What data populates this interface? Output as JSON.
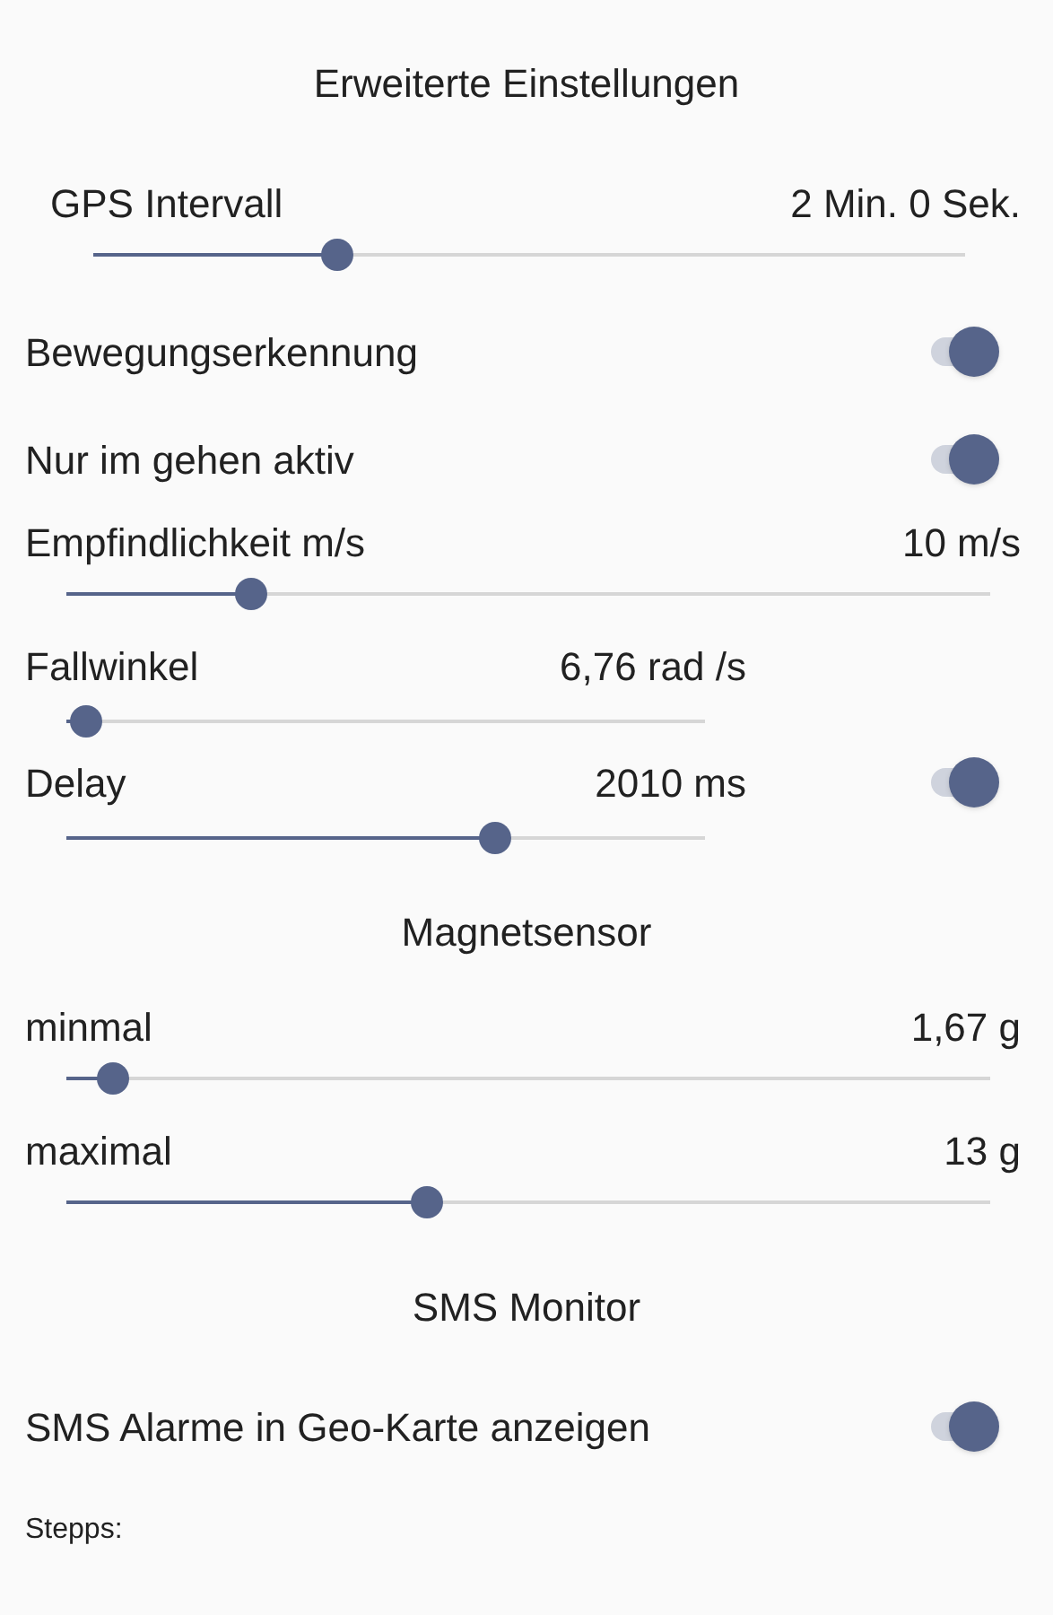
{
  "title": "Erweiterte Einstellungen",
  "items": [
    {
      "kind": "slider",
      "label": "GPS Intervall",
      "reading": "2 Min. 0 Sek.",
      "level": 0.28,
      "indented": true
    },
    {
      "kind": "switch",
      "label": "Bewegungserkennung",
      "on": true
    },
    {
      "kind": "switch",
      "label": "Nur im gehen aktiv",
      "on": true
    },
    {
      "kind": "slider",
      "label": "Empfindlichkeit m/s",
      "reading": "10 m/s",
      "level": 0.2,
      "indented": false
    },
    {
      "kind": "short_slider",
      "label": "Fallwinkel",
      "reading": "6,76 rad /s",
      "level": 0.03
    },
    {
      "kind": "short_slider",
      "label": "Delay",
      "reading": "2010 ms",
      "level": 0.67,
      "on": true
    },
    {
      "kind": "heading",
      "label": "Magnetsensor"
    },
    {
      "kind": "slider",
      "label": "minmal",
      "reading": "1,67 g",
      "level": 0.05,
      "indented": false
    },
    {
      "kind": "slider",
      "label": "maximal",
      "reading": "13 g",
      "level": 0.39,
      "indented": false
    },
    {
      "kind": "heading",
      "label": "SMS Monitor"
    },
    {
      "kind": "switch",
      "label": "SMS Alarme in Geo-Karte anzeigen",
      "on": true
    },
    {
      "kind": "note",
      "label": "Stepps:"
    }
  ]
}
